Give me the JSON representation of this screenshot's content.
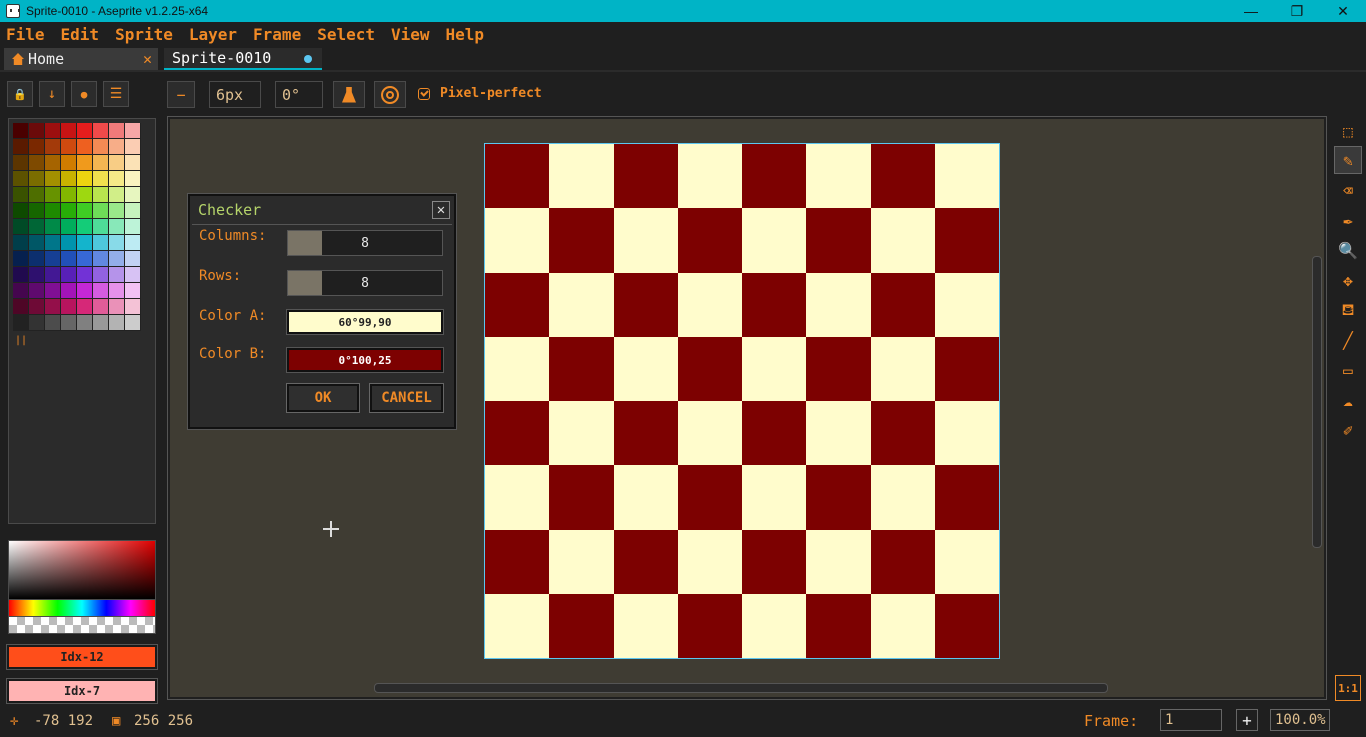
{
  "window": {
    "title": "Sprite-0010 - Aseprite v1.2.25-x64",
    "minimize": "—",
    "maximize": "❐",
    "close": "✕"
  },
  "menu": [
    "File",
    "Edit",
    "Sprite",
    "Layer",
    "Frame",
    "Select",
    "View",
    "Help"
  ],
  "tabs": {
    "home": "Home",
    "home_close": "✕",
    "sprite": "Sprite-0010"
  },
  "layer_toolbar": {
    "lock": "🔒",
    "down": "↓",
    "circle": "●",
    "menu": "☰"
  },
  "context_bar": {
    "minus": "−",
    "brush_size": "6px",
    "brush_angle": "0°",
    "pixel_perfect_label": "Pixel-perfect"
  },
  "palette": {
    "rows": [
      [
        "#4a0000",
        "#6b0a0a",
        "#9c0f0f",
        "#c71414",
        "#e51d1d",
        "#f04a4a",
        "#f07a7a",
        "#f7a7a7"
      ],
      [
        "#5a1a00",
        "#7a2800",
        "#a33a0a",
        "#cf4a0f",
        "#ee6020",
        "#f48a54",
        "#f7ad88",
        "#fbcdb3"
      ],
      [
        "#5c3500",
        "#7e4a00",
        "#a66400",
        "#d07c00",
        "#f09a1c",
        "#f4b552",
        "#f8cd85",
        "#fbe2b6"
      ],
      [
        "#5c5200",
        "#7b6d00",
        "#a39000",
        "#c9b200",
        "#ecd410",
        "#f0e04e",
        "#f5ea88",
        "#faf3bf"
      ],
      [
        "#3a5200",
        "#4e6e00",
        "#679300",
        "#82b700",
        "#9ed810",
        "#b9e44e",
        "#d1ee88",
        "#e7f6bf"
      ],
      [
        "#0e4a00",
        "#166600",
        "#1e8a00",
        "#28ad08",
        "#3fcc24",
        "#6edc58",
        "#9ae88a",
        "#c6f3bd"
      ],
      [
        "#004a26",
        "#006636",
        "#008a48",
        "#00ad5c",
        "#14cc78",
        "#4edc98",
        "#88e8b9",
        "#bdf3d8"
      ],
      [
        "#003e4a",
        "#005766",
        "#00768a",
        "#0094ad",
        "#14b4cc",
        "#4ec8dc",
        "#88dae8",
        "#bdebf3"
      ],
      [
        "#06204e",
        "#0c2f6e",
        "#163f94",
        "#2150b8",
        "#3768d6",
        "#6288e0",
        "#93aeea",
        "#c2d2f4"
      ],
      [
        "#200a4e",
        "#2e106e",
        "#431894",
        "#5820b8",
        "#7232d6",
        "#9262e0",
        "#b593ea",
        "#d7c2f4"
      ],
      [
        "#45064e",
        "#5f0a6e",
        "#800f94",
        "#a314b8",
        "#c428d6",
        "#d65ce0",
        "#e591ea",
        "#f2c2f4"
      ],
      [
        "#4e0626",
        "#6e0a36",
        "#940f4a",
        "#b8145e",
        "#d62878",
        "#e05c98",
        "#ea91b8",
        "#f4c2d6"
      ],
      [
        "#222222",
        "#333333",
        "#4c4c4c",
        "#666666",
        "#808080",
        "#999999",
        "#b3b3b3",
        "#cccccc"
      ]
    ],
    "grip": "||"
  },
  "colors": {
    "fg_label": "Idx-12",
    "fg_color": "#ff4e1a",
    "bg_label": "Idx-7",
    "bg_color": "#ffb3b3",
    "accent": "#f08a26",
    "cell_a": "#7d0101",
    "cell_b": "#fffccc"
  },
  "dialog": {
    "title": "Checker",
    "close": "✕",
    "columns_label": "Columns:",
    "columns_value": "8",
    "columns_fill": 0.22,
    "rows_label": "Rows:",
    "rows_value": "8",
    "rows_fill": 0.22,
    "color_a_label": "Color A:",
    "color_a_value": "60°99,90",
    "color_a_hex": "#fffccc",
    "color_b_label": "Color B:",
    "color_b_value": "0°100,25",
    "color_b_hex": "#7d0101",
    "ok": "OK",
    "cancel": "CANCEL"
  },
  "tools": [
    {
      "icon": "marquee-icon",
      "glyph": "⬚"
    },
    {
      "icon": "pencil-icon",
      "glyph": "✎"
    },
    {
      "icon": "eraser-icon",
      "glyph": "⌫"
    },
    {
      "icon": "eyedropper-icon",
      "glyph": "✒"
    },
    {
      "icon": "zoom-icon",
      "glyph": "🔍"
    },
    {
      "icon": "move-icon",
      "glyph": "✥"
    },
    {
      "icon": "paint-bucket-icon",
      "glyph": "⛾"
    },
    {
      "icon": "line-icon",
      "glyph": "╱"
    },
    {
      "icon": "rectangle-icon",
      "glyph": "▭"
    },
    {
      "icon": "blur-icon",
      "glyph": "☁"
    },
    {
      "icon": "spray-icon",
      "glyph": "✐"
    }
  ],
  "status": {
    "position": "-78 192",
    "size": "256 256",
    "frame_label": "Frame:",
    "frame_value": "1",
    "add_frame": "+",
    "zoom": "100.0%",
    "one_to_one": "1:1"
  }
}
